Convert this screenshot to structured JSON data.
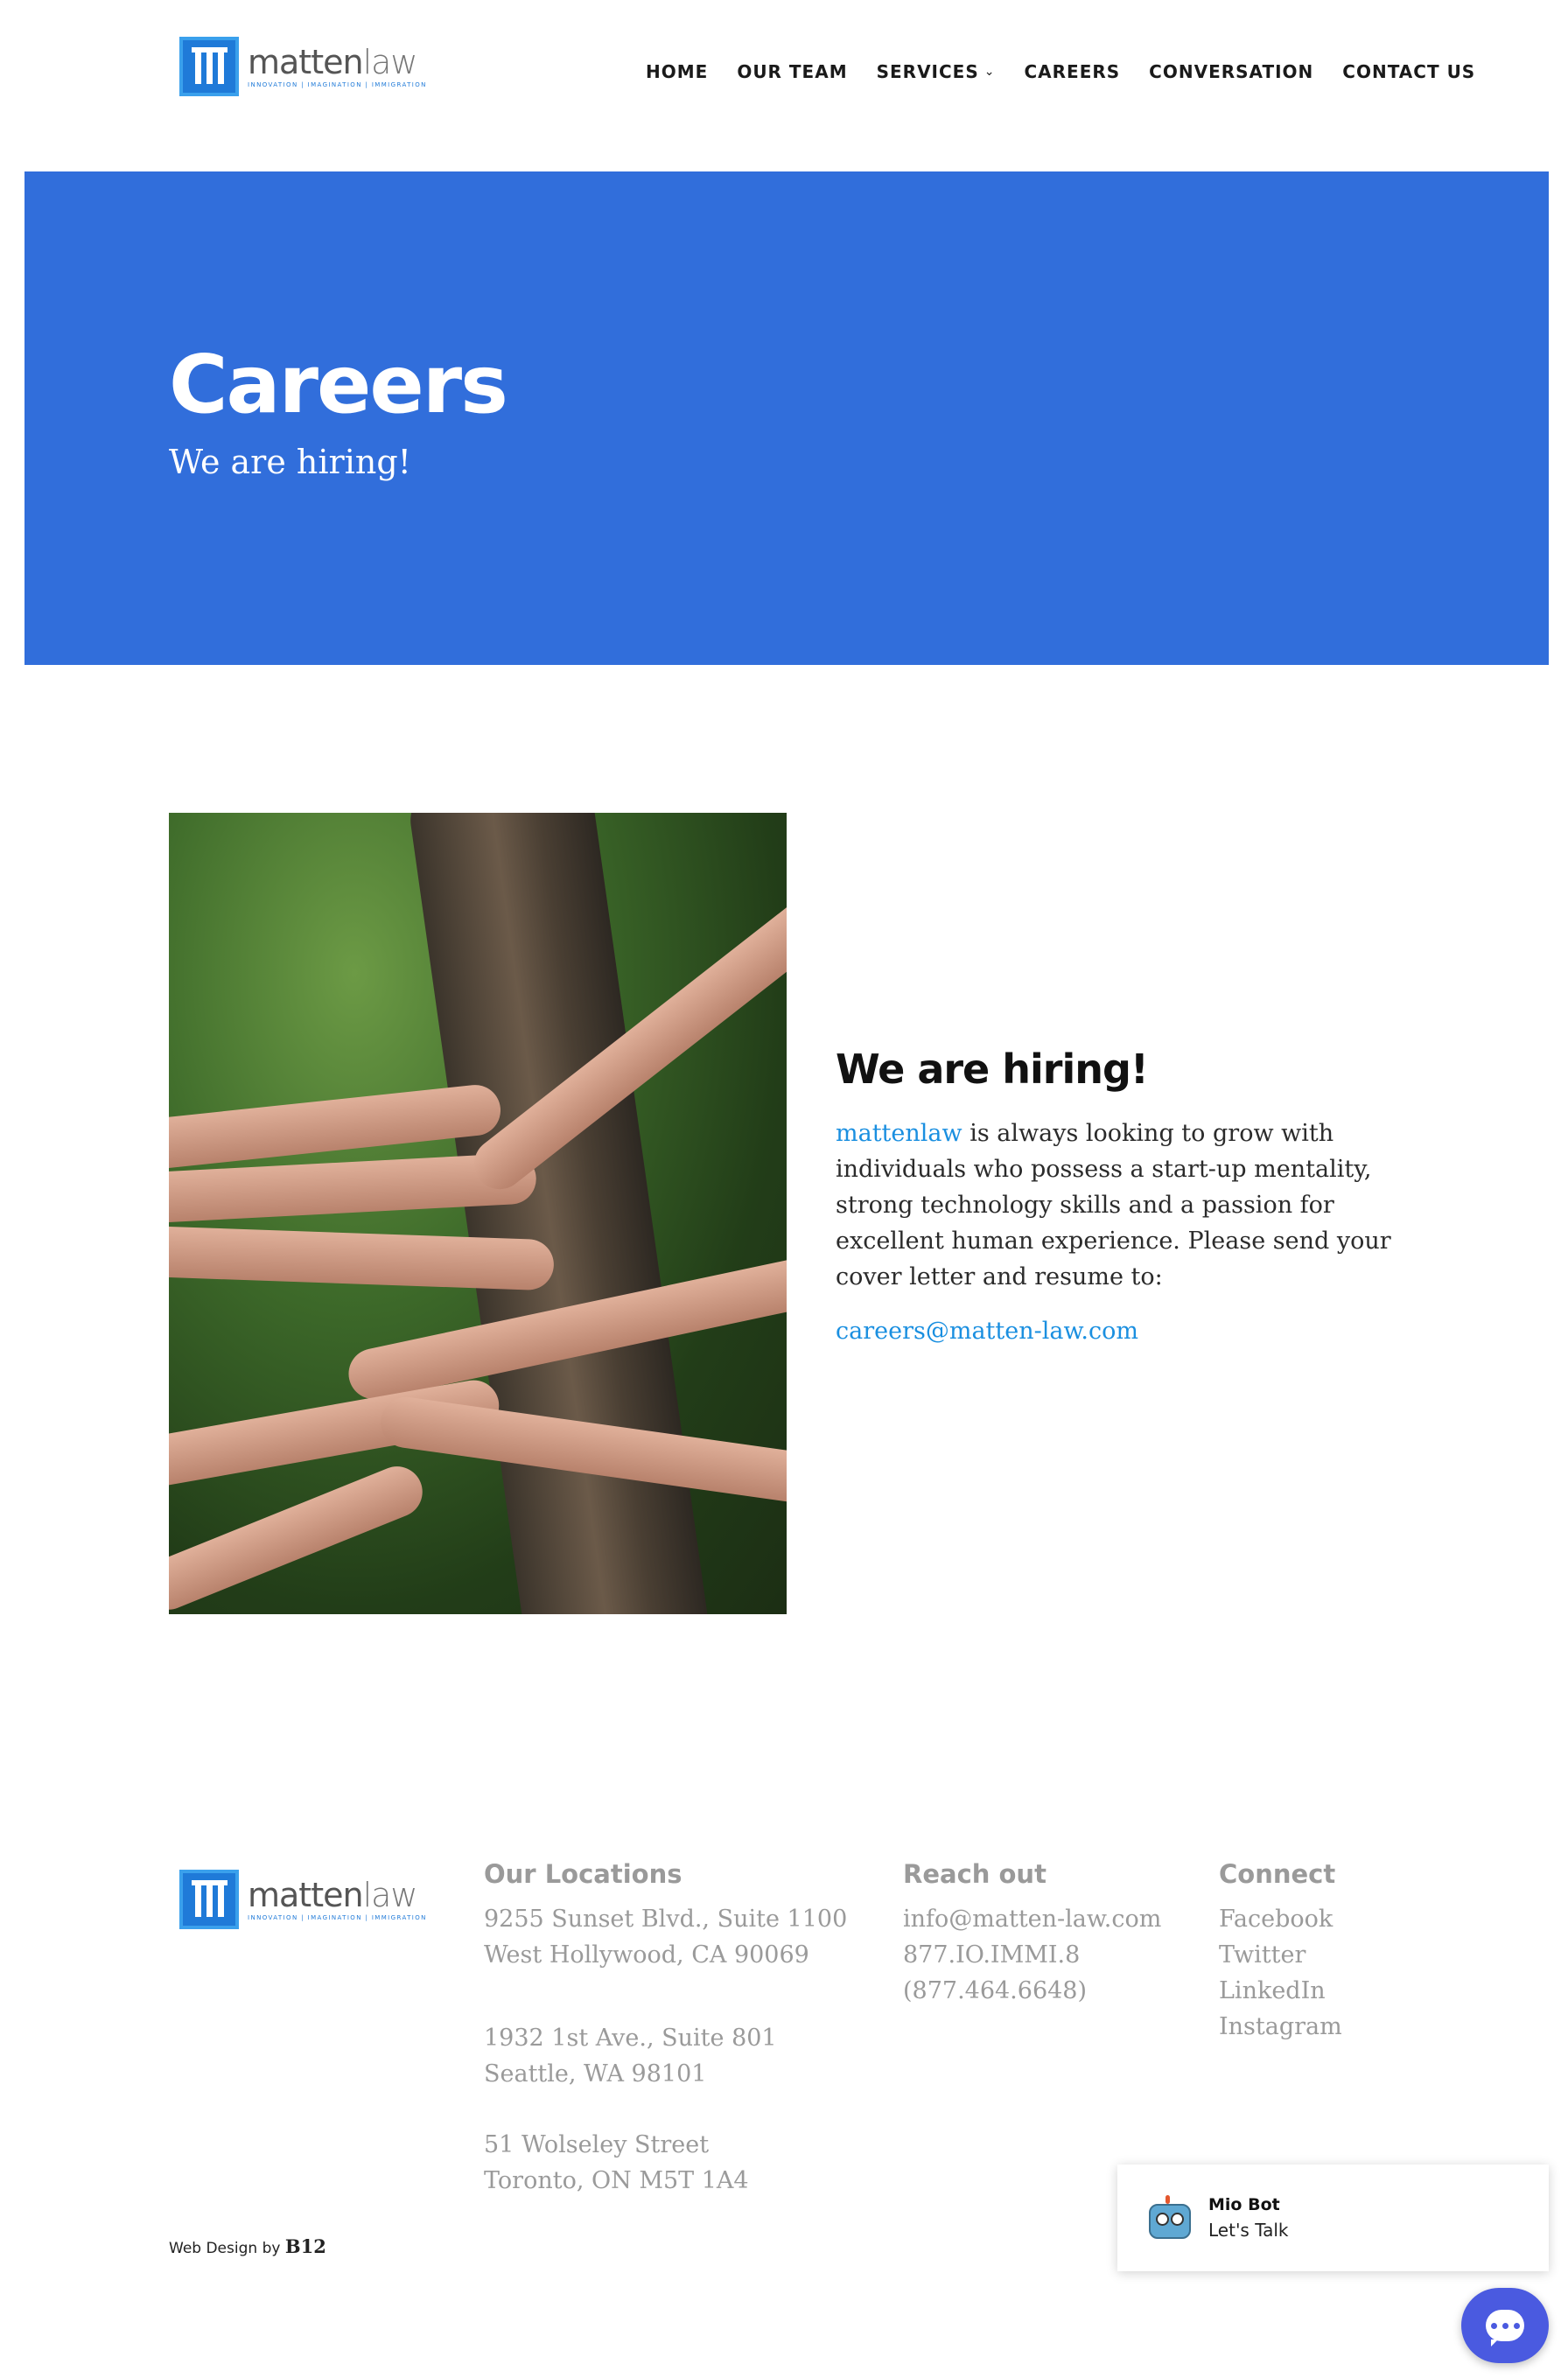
{
  "logo": {
    "name_bold": "matten",
    "name_light": "law",
    "tagline": "INNOVATION | IMAGINATION | IMMIGRATION"
  },
  "nav": {
    "home": "HOME",
    "our_team": "OUR TEAM",
    "services": "SERVICES",
    "careers": "CAREERS",
    "conversation": "CONVERSATION",
    "contact_us": "CONTACT US"
  },
  "hero": {
    "title": "Careers",
    "subtitle": "We are hiring!"
  },
  "main": {
    "heading": "We are hiring!",
    "brand_link": "mattenlaw",
    "body": " is always looking to grow with individuals who possess a start-up mentality, strong technology skills and a passion for excellent human experience. Please send your cover letter and resume to:",
    "email": "careers@matten-law.com"
  },
  "footer": {
    "locations": {
      "heading": "Our Locations",
      "la_line1": "9255 Sunset Blvd., Suite 1100",
      "la_line2": "West Hollywood, CA 90069",
      "sea_line1": "1932 1st Ave., Suite 801",
      "sea_line2": "Seattle, WA 98101",
      "tor_line1": "51 Wolseley Street",
      "tor_line2": "Toronto, ON M5T 1A4"
    },
    "reach": {
      "heading": "Reach out",
      "email": "info@matten-law.com",
      "phone_vanity": "877.IO.IMMI.8",
      "phone_digits": "(877.464.6648)"
    },
    "connect": {
      "heading": "Connect",
      "facebook": "Facebook",
      "twitter": "Twitter",
      "linkedin": "LinkedIn",
      "instagram": "Instagram"
    },
    "credit_prefix": "Web Design by ",
    "credit_brand": "B12"
  },
  "chat": {
    "bot_name": "Mio Bot",
    "message": "Let's Talk"
  },
  "colors": {
    "hero_bg": "#316edb",
    "link": "#1a8fe0",
    "chat_button": "#4a5ae0"
  }
}
